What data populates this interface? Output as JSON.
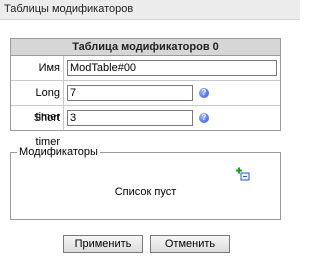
{
  "header": {
    "title": "Таблицы модификаторов"
  },
  "table": {
    "caption": "Таблица модификаторов 0",
    "fields": [
      {
        "label": "Имя",
        "value": "ModTable#00"
      },
      {
        "label": "Long timer",
        "value": "7"
      },
      {
        "label": "Short timer",
        "value": "3"
      }
    ]
  },
  "modifiers": {
    "legend": "Модификаторы",
    "empty_text": "Список пуст"
  },
  "buttons": {
    "apply": "Применить",
    "cancel": "Отменить"
  },
  "icons": {
    "help": "help-icon",
    "add": "add-icon"
  }
}
